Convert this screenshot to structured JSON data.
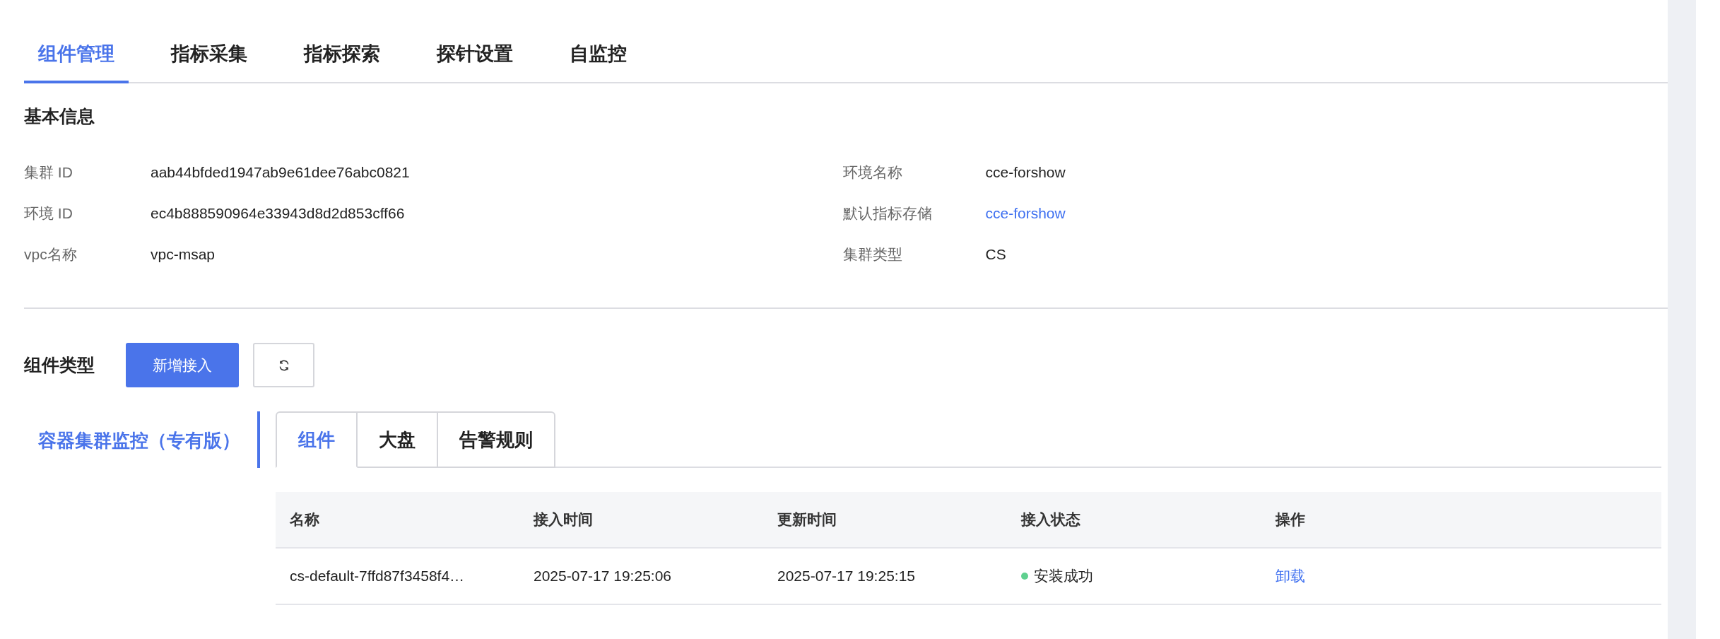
{
  "tabs": [
    {
      "label": "组件管理",
      "selected": true
    },
    {
      "label": "指标采集",
      "selected": false
    },
    {
      "label": "指标探索",
      "selected": false
    },
    {
      "label": "探针设置",
      "selected": false
    },
    {
      "label": "自监控",
      "selected": false
    }
  ],
  "basic_info": {
    "title": "基本信息",
    "left": [
      {
        "label": "集群 ID",
        "value": "aab44bfded1947ab9e61dee76abc0821",
        "kind": "text"
      },
      {
        "label": "环境 ID",
        "value": "ec4b888590964e33943d8d2d853cff66",
        "kind": "text"
      },
      {
        "label": "vpc名称",
        "value": "vpc-msap",
        "kind": "text"
      }
    ],
    "right": [
      {
        "label": "环境名称",
        "value": "cce-forshow",
        "kind": "text"
      },
      {
        "label": "默认指标存储",
        "value": "cce-forshow",
        "kind": "link"
      },
      {
        "label": "集群类型",
        "value": "CS",
        "kind": "text"
      }
    ]
  },
  "component_types": {
    "title": "组件类型",
    "add_button": "新增接入",
    "side_items": [
      {
        "label": "容器集群监控（专有版）",
        "selected": true
      }
    ],
    "tabs": [
      {
        "label": "组件",
        "selected": true
      },
      {
        "label": "大盘",
        "selected": false
      },
      {
        "label": "告警规则",
        "selected": false
      }
    ],
    "table": {
      "columns": [
        "名称",
        "接入时间",
        "更新时间",
        "接入状态",
        "操作"
      ],
      "rows": [
        {
          "name": "cs-default-7ffd87f3458f4…",
          "created": "2025-07-17 19:25:06",
          "updated": "2025-07-17 19:25:15",
          "status": "安装成功",
          "color": "#5fd08f",
          "action": "卸载"
        }
      ]
    }
  }
}
